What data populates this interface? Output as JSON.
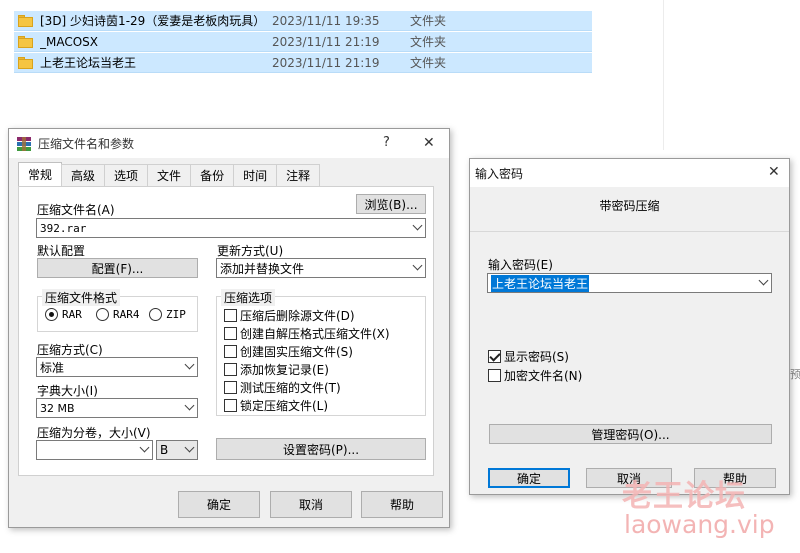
{
  "explorer": {
    "files": [
      {
        "name": "[3D] 少妇诗茵1-29（爱妻是老板肉玩具）",
        "date": "2023/11/11 19:35",
        "type": "文件夹"
      },
      {
        "name": "_MACOSX",
        "date": "2023/11/11 21:19",
        "type": "文件夹"
      },
      {
        "name": "上老王论坛当老王",
        "date": "2023/11/11 21:19",
        "type": "文件夹"
      }
    ],
    "stray_char": "预"
  },
  "archive_dialog": {
    "title": "压缩文件名和参数",
    "help_glyph": "?",
    "close_glyph": "✕",
    "tabs": [
      "常规",
      "高级",
      "选项",
      "文件",
      "备份",
      "时间",
      "注释"
    ],
    "active_tab": "常规",
    "archive_name_label": "压缩文件名(A)",
    "browse_button": "浏览(B)...",
    "archive_name_value": "392.rar",
    "default_profile_label": "默认配置",
    "profiles_button": "配置(F)...",
    "update_mode_label": "更新方式(U)",
    "update_mode_value": "添加并替换文件",
    "format_group_title": "压缩文件格式",
    "formats": [
      {
        "label": "RAR",
        "selected": true
      },
      {
        "label": "RAR4",
        "selected": false
      },
      {
        "label": "ZIP",
        "selected": false
      }
    ],
    "method_label": "压缩方式(C)",
    "method_value": "标准",
    "dict_label": "字典大小(I)",
    "dict_value": "32 MB",
    "split_label": "压缩为分卷，大小(V)",
    "split_value": "",
    "split_unit": "B",
    "options_group_title": "压缩选项",
    "options": [
      {
        "label": "压缩后删除源文件(D)",
        "checked": false
      },
      {
        "label": "创建自解压格式压缩文件(X)",
        "checked": false
      },
      {
        "label": "创建固实压缩文件(S)",
        "checked": false
      },
      {
        "label": "添加恢复记录(E)",
        "checked": false
      },
      {
        "label": "测试压缩的文件(T)",
        "checked": false
      },
      {
        "label": "锁定压缩文件(L)",
        "checked": false
      }
    ],
    "set_password_button": "设置密码(P)...",
    "ok_button": "确定",
    "cancel_button": "取消",
    "help_button": "帮助"
  },
  "password_dialog": {
    "title": "输入密码",
    "close_glyph": "✕",
    "heading": "带密码压缩",
    "password_label": "输入密码(E)",
    "password_value": "上老王论坛当老王",
    "show_password_label": "显示密码(S)",
    "show_password_checked": true,
    "encrypt_names_label": "加密文件名(N)",
    "encrypt_names_checked": false,
    "organize_button": "管理密码(O)...",
    "ok_button": "确定",
    "cancel_button": "取消",
    "help_button": "帮助"
  },
  "watermark": {
    "text_cn": "老王论坛",
    "text_url": "laowang.vip"
  },
  "colors": {
    "selection": "#cce8ff",
    "dialog_bg": "#f0f0f0",
    "accent_button_border": "#0078d7",
    "highlight_text": "#0078d7",
    "watermark": "#f4b4b4"
  }
}
